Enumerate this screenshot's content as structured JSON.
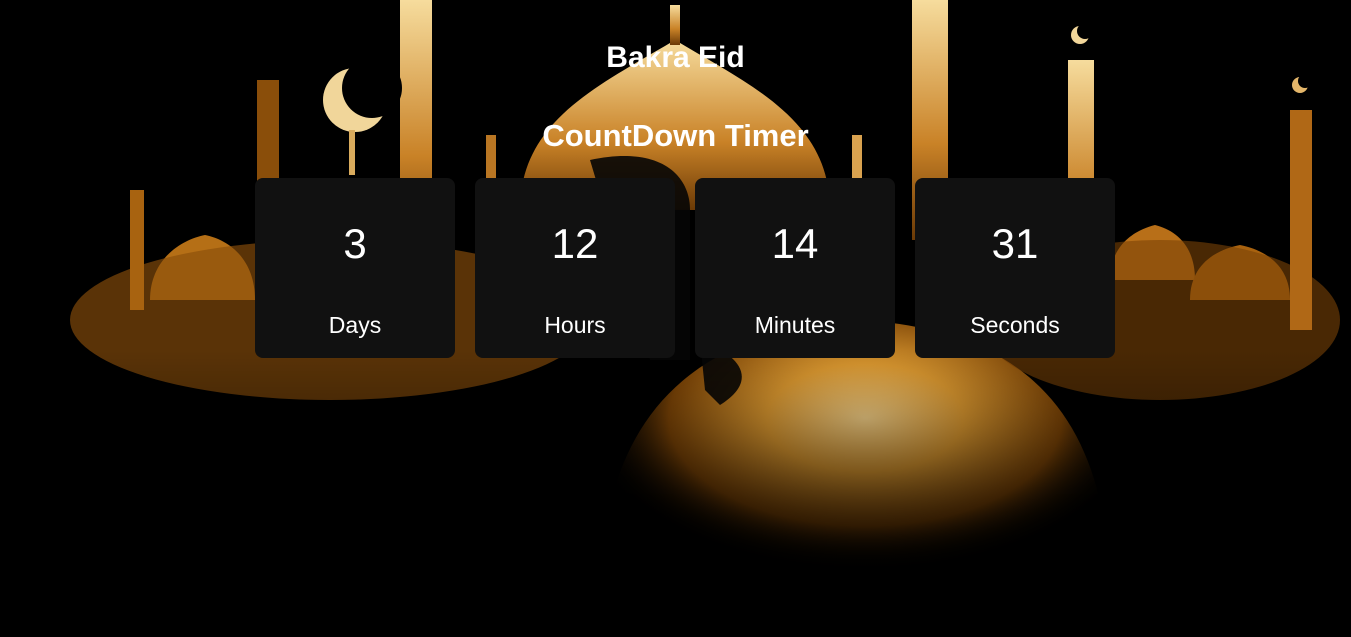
{
  "header": {
    "title": "Bakra Eid",
    "subtitle": "CountDown Timer"
  },
  "timer": {
    "units": [
      {
        "value": "3",
        "label": "Days"
      },
      {
        "value": "12",
        "label": "Hours"
      },
      {
        "value": "14",
        "label": "Minutes"
      },
      {
        "value": "31",
        "label": "Seconds"
      }
    ]
  },
  "colors": {
    "background": "#000000",
    "card": "#111111",
    "text": "#ffffff",
    "gold_light": "#f2d08a",
    "gold_dark": "#b8741a"
  },
  "icons": {
    "crescent": "crescent-moon-icon",
    "mosque": "mosque-silhouette"
  }
}
